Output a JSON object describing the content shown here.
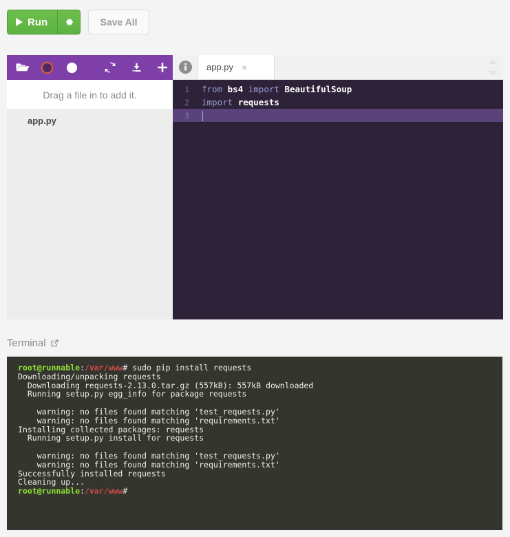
{
  "toolbar": {
    "run_label": "Run",
    "run_settings_icon": "gear-icon",
    "save_all_label": "Save All"
  },
  "file_panel": {
    "toolbar_icons": [
      {
        "name": "open-folder-icon",
        "title": "Open folder"
      },
      {
        "name": "record-circle-icon",
        "title": "Record"
      },
      {
        "name": "filled-circle-icon",
        "title": "Snapshot"
      },
      {
        "name": "refresh-icon",
        "title": "Refresh"
      },
      {
        "name": "download-icon",
        "title": "Download"
      },
      {
        "name": "add-file-icon",
        "title": "Add file"
      }
    ],
    "dropzone_text": "Drag a file in to add it.",
    "files": [
      {
        "name": "app.py"
      }
    ]
  },
  "editor": {
    "info_icon": "info-icon",
    "tabs": [
      {
        "label": "app.py",
        "close_label": "×",
        "active": true
      }
    ],
    "scroller": {
      "up_icon": "chevron-up-icon",
      "down_icon": "chevron-down-icon"
    },
    "lines": [
      {
        "number": "1",
        "tokens": [
          {
            "text": "from ",
            "type": "keyword"
          },
          {
            "text": "bs4",
            "type": "identifier"
          },
          {
            "text": " ",
            "type": "plain"
          },
          {
            "text": "import ",
            "type": "keyword"
          },
          {
            "text": "BeautifulSoup",
            "type": "identifier"
          }
        ]
      },
      {
        "number": "2",
        "tokens": [
          {
            "text": "import ",
            "type": "keyword"
          },
          {
            "text": "requests",
            "type": "identifier"
          }
        ]
      },
      {
        "number": "3",
        "tokens": [],
        "active": true
      }
    ]
  },
  "terminal": {
    "label": "Terminal",
    "popout_icon": "external-link-icon",
    "lines": [
      {
        "segments": [
          {
            "text": "root@runnable",
            "color": "green"
          },
          {
            "text": ":",
            "color": "white"
          },
          {
            "text": "/var/www",
            "color": "red"
          },
          {
            "text": "# sudo pip install requests",
            "color": "white"
          }
        ]
      },
      {
        "segments": [
          {
            "text": "Downloading/unpacking requests",
            "color": "white"
          }
        ]
      },
      {
        "segments": [
          {
            "text": "  Downloading requests-2.13.0.tar.gz (557kB): 557kB downloaded",
            "color": "white"
          }
        ]
      },
      {
        "segments": [
          {
            "text": "  Running setup.py egg_info for package requests",
            "color": "white"
          }
        ]
      },
      {
        "segments": [
          {
            "text": "",
            "color": "white"
          }
        ]
      },
      {
        "segments": [
          {
            "text": "    warning: no files found matching 'test_requests.py'",
            "color": "white"
          }
        ]
      },
      {
        "segments": [
          {
            "text": "    warning: no files found matching 'requirements.txt'",
            "color": "white"
          }
        ]
      },
      {
        "segments": [
          {
            "text": "Installing collected packages: requests",
            "color": "white"
          }
        ]
      },
      {
        "segments": [
          {
            "text": "  Running setup.py install for requests",
            "color": "white"
          }
        ]
      },
      {
        "segments": [
          {
            "text": "",
            "color": "white"
          }
        ]
      },
      {
        "segments": [
          {
            "text": "    warning: no files found matching 'test_requests.py'",
            "color": "white"
          }
        ]
      },
      {
        "segments": [
          {
            "text": "    warning: no files found matching 'requirements.txt'",
            "color": "white"
          }
        ]
      },
      {
        "segments": [
          {
            "text": "Successfully installed requests",
            "color": "white"
          }
        ]
      },
      {
        "segments": [
          {
            "text": "Cleaning up...",
            "color": "white"
          }
        ]
      },
      {
        "segments": [
          {
            "text": "root@runnable",
            "color": "green"
          },
          {
            "text": ":",
            "color": "white"
          },
          {
            "text": "/var/www",
            "color": "red"
          },
          {
            "text": "#",
            "color": "white"
          }
        ]
      }
    ]
  },
  "colors": {
    "run_green": "#5cb243",
    "toolbar_purple": "#7e3fa8",
    "editor_bg": "#2e2239",
    "active_line": "#59437a",
    "terminal_bg": "#35352f",
    "prompt_green": "#8ae234",
    "prompt_red": "#cc4a4a"
  }
}
